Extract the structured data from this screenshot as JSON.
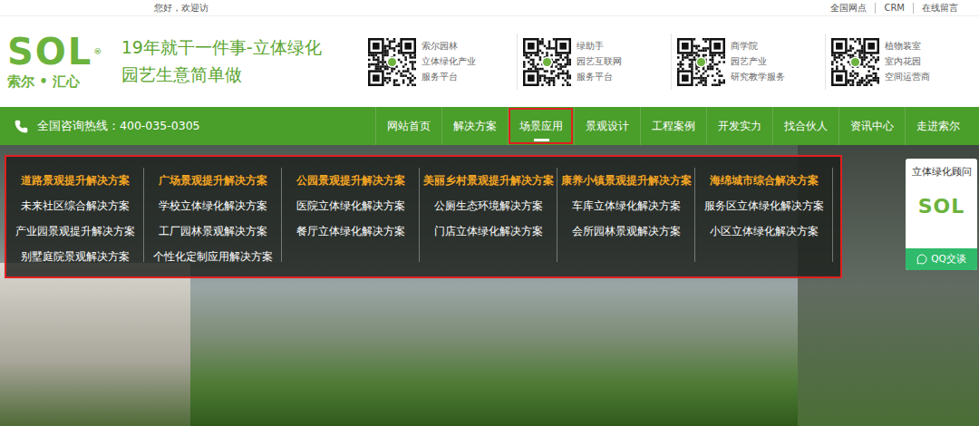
{
  "topbar": {
    "greeting": "您好，欢迎访",
    "links": [
      "全国网点",
      "CRM",
      "在线留言"
    ]
  },
  "header": {
    "logo": {
      "mark": "SOL",
      "reg": "®",
      "name": "索尔 • 汇心"
    },
    "slogan": [
      "19年就干一件事-立体绿化",
      "园艺生意简单做"
    ],
    "qrs": [
      {
        "lines": [
          "索尔园林",
          "立体绿化产业",
          "服务平台"
        ]
      },
      {
        "lines": [
          "绿助手",
          "园艺互联网",
          "服务平台"
        ]
      },
      {
        "lines": [
          "商学院",
          "园艺产业",
          "研究教学服务"
        ]
      },
      {
        "lines": [
          "植物装室",
          "室内花园",
          "空间运营商"
        ]
      }
    ]
  },
  "nav": {
    "hotline": "全国咨询热线：400-035-0305",
    "items": [
      {
        "label": "网站首页",
        "selected": false
      },
      {
        "label": "解决方案",
        "selected": false
      },
      {
        "label": "场景应用",
        "selected": true
      },
      {
        "label": "景观设计",
        "selected": false
      },
      {
        "label": "工程案例",
        "selected": false
      },
      {
        "label": "开发实力",
        "selected": false
      },
      {
        "label": "找合伙人",
        "selected": false
      },
      {
        "label": "资讯中心",
        "selected": false
      },
      {
        "label": "走进索尔",
        "selected": false
      }
    ]
  },
  "dropdown": {
    "columns": [
      {
        "title": "道路景观提升解决方案",
        "items": [
          "未来社区综合解决方案",
          "产业园景观提升解决方案",
          "别墅庭院景观解决方案"
        ]
      },
      {
        "title": "广场景观提升解决方案",
        "items": [
          "学校立体绿化解决方案",
          "工厂园林景观解决方案",
          "个性化定制应用解决方案"
        ]
      },
      {
        "title": "公园景观提升解决方案",
        "items": [
          "医院立体绿化解决方案",
          "餐厅立体绿化解决方案"
        ]
      },
      {
        "title": "美丽乡村景观提升解决方案",
        "items": [
          "公厕生态环境解决方案",
          "门店立体绿化解决方案"
        ]
      },
      {
        "title": "康养小镇景观提升解决方案",
        "items": [
          "车库立体绿化解决方案",
          "会所园林景观解决方案"
        ]
      },
      {
        "title": "海绵城市综合解决方案",
        "items": [
          "服务区立体绿化解决方案",
          "小区立体绿化解决方案"
        ]
      }
    ]
  },
  "widget": {
    "title": "立体绿化顾问",
    "logo": "SOL",
    "button": "QQ交谈"
  }
}
